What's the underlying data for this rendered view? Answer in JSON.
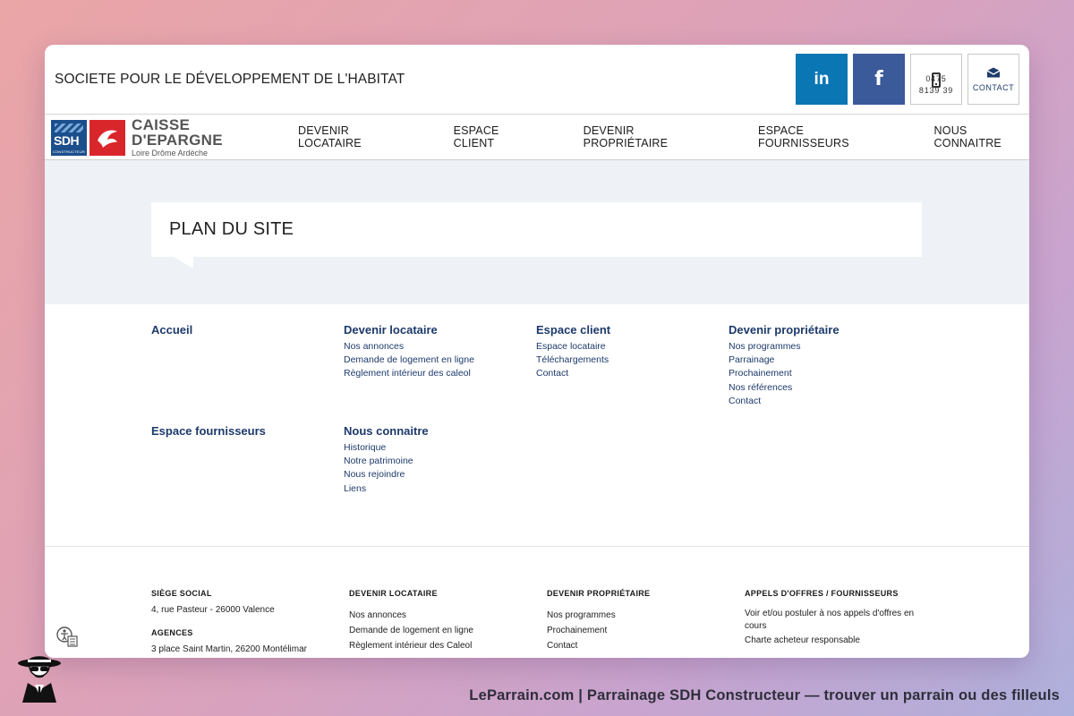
{
  "header": {
    "company_name": "SOCIETE POUR LE DÉVELOPPEMENT DE L'HABITAT",
    "linkedin_label": "in",
    "facebook_label": "f",
    "phone_text": "0475 8139 39",
    "contact_label": "CONTACT"
  },
  "logo": {
    "sdh": "SDH",
    "sdh_sub": "CONSTRUCTEUR",
    "brand_line1": "CAISSE",
    "brand_line2": "D'EPARGNE",
    "brand_line3": "Loire Drôme Ardèche"
  },
  "nav": {
    "items": [
      "DEVENIR LOCATAIRE",
      "ESPACE CLIENT",
      "DEVENIR PROPRIÉTAIRE",
      "ESPACE FOURNISSEURS",
      "NOUS CONNAITRE"
    ]
  },
  "page": {
    "title": "PLAN DU SITE"
  },
  "sitemap": {
    "accueil": {
      "title": "Accueil"
    },
    "locataire": {
      "title": "Devenir locataire",
      "links": [
        "Nos annonces",
        "Demande de logement en ligne",
        "Règlement intérieur des caleol"
      ]
    },
    "client": {
      "title": "Espace client",
      "links": [
        "Espace locataire",
        "Téléchargements",
        "Contact"
      ]
    },
    "proprietaire": {
      "title": "Devenir propriétaire",
      "links": [
        "Nos programmes",
        "Parrainage",
        "Prochainement",
        "Nos références",
        "Contact"
      ]
    },
    "fournisseurs": {
      "title": "Espace fournisseurs"
    },
    "connaitre": {
      "title": "Nous connaitre",
      "links": [
        "Historique",
        "Notre patrimoine",
        "Nous rejoindre",
        "Liens"
      ]
    }
  },
  "footer": {
    "siege": {
      "title": "SIÈGE SOCIAL",
      "address": "4, rue Pasteur - 26000 Valence",
      "agences_title": "AGENCES",
      "agence1": "3 place Saint Martin, 26200 Montélimar"
    },
    "locataire": {
      "title": "DEVENIR LOCATAIRE",
      "links": [
        "Nos annonces",
        "Demande de logement en ligne",
        "Règlement intérieur des Caleol"
      ]
    },
    "proprietaire": {
      "title": "DEVENIR PROPRIÉTAIRE",
      "links": [
        "Nos programmes",
        "Prochainement",
        "Contact"
      ]
    },
    "fournisseurs": {
      "title": "APPELS D'OFFRES / FOURNISSEURS",
      "links": [
        "Voir et/ou postuler à nos appels d'offres en cours",
        "Charte acheteur responsable"
      ]
    }
  },
  "caption": "LeParrain.com | Parrainage SDH Constructeur — trouver un parrain ou des filleuls",
  "colors": {
    "linkedin": "#0a76b4",
    "facebook": "#3b5a9a",
    "link_blue": "#1d3a6b",
    "caisse_red": "#d9262b",
    "sdh_blue": "#1b4f8c"
  }
}
